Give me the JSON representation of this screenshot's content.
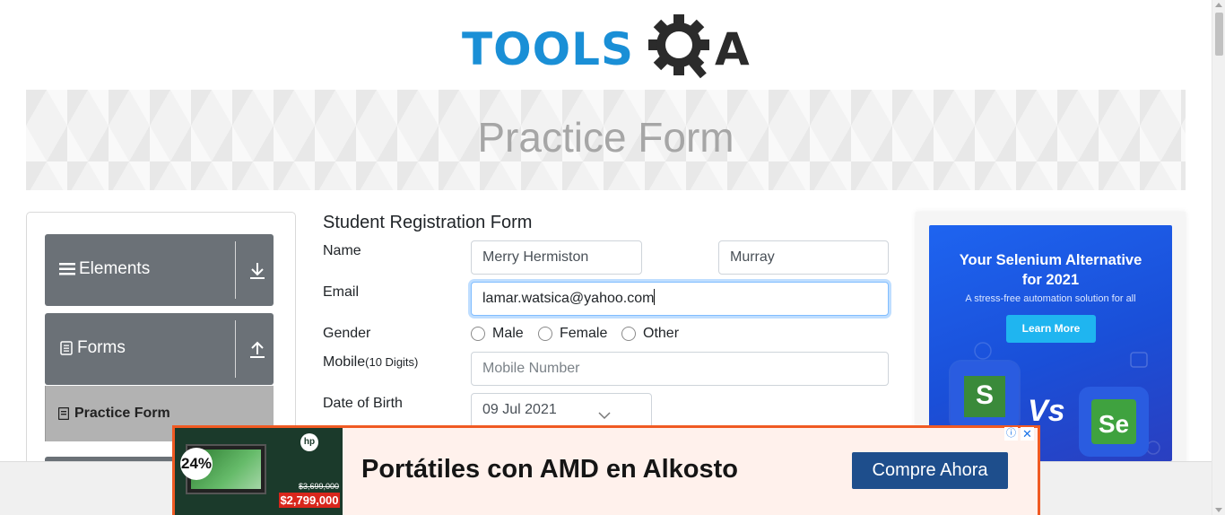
{
  "header": {
    "logo_text": "TOOLS",
    "logo_suffix": "A",
    "banner_title": "Practice Form"
  },
  "sidebar": {
    "groups": [
      {
        "label": "Elements",
        "icon": "hamburger-icon",
        "toggle_icon": "download-arrow-icon"
      },
      {
        "label": "Forms",
        "icon": "document-icon",
        "toggle_icon": "upload-arrow-icon"
      }
    ],
    "active_item": {
      "label": "Practice Form",
      "icon": "notebook-icon"
    }
  },
  "form": {
    "title": "Student Registration Form",
    "name_label": "Name",
    "first_name_value": "Merry Hermiston",
    "last_name_value": "Murray",
    "email_label": "Email",
    "email_value": "lamar.watsica@yahoo.com",
    "gender_label": "Gender",
    "gender_options": [
      "Male",
      "Female",
      "Other"
    ],
    "mobile_label": "Mobile",
    "mobile_hint": "(10 Digits)",
    "mobile_placeholder": "Mobile Number",
    "dob_label": "Date of Birth",
    "dob_value": "09 Jul 2021"
  },
  "right_ad": {
    "headline_line1": "Your Selenium Alternative",
    "headline_line2": "for 2021",
    "subtext": "A stress-free automation solution for all",
    "button_label": "Learn More",
    "left_logo": "S",
    "versus": "Vs",
    "right_logo": "Se"
  },
  "bottom_ad": {
    "discount": "24%",
    "brand": "hp",
    "old_price": "$3,699,000",
    "price": "$2,799,000",
    "headline": "Portátiles con AMD en Alkosto",
    "cta_label": "Compre Ahora",
    "info_icon": "ⓘ",
    "close_icon": "✕"
  },
  "colors": {
    "brand_blue": "#1a8fd6",
    "sidebar_gray": "#6b7177",
    "active_item_gray": "#b2b2b2",
    "focus_blue": "#80bdff",
    "ad_orange": "#f05a23",
    "cta_navy": "#1e4e8c"
  }
}
